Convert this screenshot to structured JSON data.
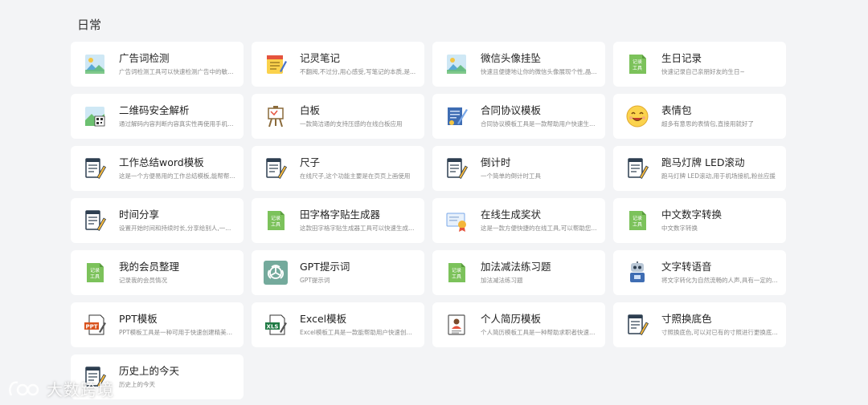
{
  "section_title": "日常",
  "watermark": "大数跨境",
  "tools": [
    {
      "name": "广告词检测",
      "desc": "广告词检测工具可以快速检测广告中的敏感词...",
      "icon": "image-picture-icon"
    },
    {
      "name": "记灵笔记",
      "desc": "不翻阅,不过分,用心感受,写笔记的本质,是...",
      "icon": "notepad-icon"
    },
    {
      "name": "微信头像挂坠",
      "desc": "快速且便捷地让你的微信头像展现个性,晶...",
      "icon": "image-picture-icon"
    },
    {
      "name": "生日记录",
      "desc": "快速记录自己亲朋好友的生日~",
      "icon": "record-tool-icon",
      "icon_text": "记录\n工具"
    },
    {
      "name": "二维码安全解析",
      "desc": "通过解码内容判断内容真实性再使用手机扫...",
      "icon": "qr-image-icon"
    },
    {
      "name": "白板",
      "desc": "一款简洁通的支持压感的在线白板应用",
      "icon": "whiteboard-easel-icon"
    },
    {
      "name": "合同协议模板",
      "desc": "合同协议模板工具是一款帮助用户快速生成...",
      "icon": "contract-document-icon"
    },
    {
      "name": "表情包",
      "desc": "超多有意思的表情包,直接用就好了",
      "icon": "smiley-emoji-icon"
    },
    {
      "name": "工作总结word模板",
      "desc": "这是一个方便易用的工作总结模板,能帮帮...",
      "icon": "document-pen-icon"
    },
    {
      "name": "尺子",
      "desc": "在线尺子,这个功能主要是在页页上画使用",
      "icon": "document-pen-icon"
    },
    {
      "name": "倒计时",
      "desc": "一个简单的倒计时工具",
      "icon": "document-pen-icon"
    },
    {
      "name": "跑马灯牌 LED滚动",
      "desc": "跑马灯牌 LED滚动,用于机场接机,粉丝应援",
      "icon": "document-pen-icon"
    },
    {
      "name": "时间分享",
      "desc": "设置开始时间和持续时长,分享给别人,一...",
      "icon": "document-pen-icon"
    },
    {
      "name": "田字格字贴生成器",
      "desc": "这款田字格字贴生成器工具可以快速生成定...",
      "icon": "record-tool-icon",
      "icon_text": "记录\n工具"
    },
    {
      "name": "在线生成奖状",
      "desc": "这是一款方便快捷的在线工具,可以帮助您...",
      "icon": "certificate-award-icon"
    },
    {
      "name": "中文数字转换",
      "desc": "中文数字转换",
      "icon": "record-tool-icon",
      "icon_text": "记录\n工具"
    },
    {
      "name": "我的会员整理",
      "desc": "记录我的会员情况",
      "icon": "record-tool-icon",
      "icon_text": "记录\n工具"
    },
    {
      "name": "GPT提示词",
      "desc": "GPT提示词",
      "icon": "openai-logo-icon"
    },
    {
      "name": "加法减法练习题",
      "desc": "加法减法练习题",
      "icon": "record-tool-icon",
      "icon_text": "记录\n工具"
    },
    {
      "name": "文字转语音",
      "desc": "将文字转化为自然流畅的人声,具有一定的...",
      "icon": "robot-icon"
    },
    {
      "name": "PPT模板",
      "desc": "PPT模板工具是一种可用于快速创建精美的演...",
      "icon": "ppt-file-icon",
      "icon_text": "PPT"
    },
    {
      "name": "Excel模板",
      "desc": "Excel模板工具是一款能帮助用户快速创建...",
      "icon": "excel-file-icon",
      "icon_text": "XLS"
    },
    {
      "name": "个人简历模板",
      "desc": "个人简历模板工具是一种帮助求职者快速创...",
      "icon": "resume-person-icon"
    },
    {
      "name": "寸照换底色",
      "desc": "寸照换底色,可以对已有的寸照进行更换底色。",
      "icon": "document-pen-icon"
    },
    {
      "name": "历史上的今天",
      "desc": "历史上的今天",
      "icon": "document-pen-icon"
    }
  ]
}
